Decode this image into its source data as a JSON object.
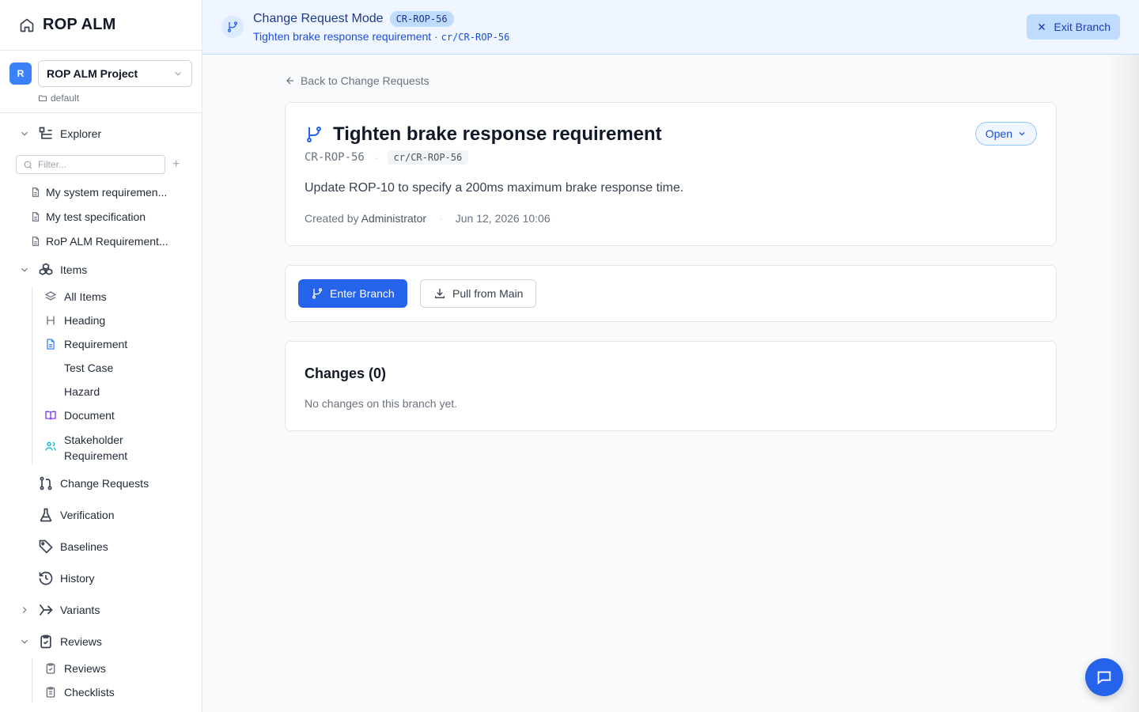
{
  "app": {
    "title": "ROP ALM"
  },
  "project": {
    "avatar": "R",
    "name": "ROP ALM Project",
    "folder": "default"
  },
  "explorer": {
    "label": "Explorer",
    "filter_placeholder": "Filter...",
    "documents": [
      "My system requiremen...",
      "My test specification",
      "RoP ALM Requirement..."
    ]
  },
  "items": {
    "label": "Items",
    "types": [
      {
        "label": "All Items",
        "icon": "layers-icon"
      },
      {
        "label": "Heading",
        "icon": "heading-icon"
      },
      {
        "label": "Requirement",
        "icon": "file-text-icon"
      },
      {
        "label": "Test Case",
        "icon": ""
      },
      {
        "label": "Hazard",
        "icon": ""
      },
      {
        "label": "Document",
        "icon": "book-open-icon"
      },
      {
        "label": "Stakeholder Requirement",
        "icon": "users-icon"
      }
    ]
  },
  "nav": {
    "change_requests": "Change Requests",
    "verification": "Verification",
    "baselines": "Baselines",
    "history": "History",
    "variants": "Variants",
    "reviews": "Reviews",
    "reviews_sub": [
      "Reviews",
      "Checklists"
    ]
  },
  "banner": {
    "title": "Change Request Mode",
    "badge": "CR-ROP-56",
    "subtitle": "Tighten brake response requirement",
    "separator": " · ",
    "branch": "cr/CR-ROP-56",
    "exit_label": "Exit Branch"
  },
  "back_link": "Back to Change Requests",
  "cr": {
    "title": "Tighten brake response requirement",
    "id": "CR-ROP-56",
    "branch": "cr/CR-ROP-56",
    "status": "Open",
    "description": "Update ROP-10 to specify a 200ms maximum brake response time.",
    "created_prefix": "Created by",
    "created_by": "Administrator",
    "created_at": "Jun 12, 2026 10:06"
  },
  "actions": {
    "enter_branch": "Enter Branch",
    "pull_from_main": "Pull from Main"
  },
  "changes": {
    "title": "Changes (0)",
    "empty": "No changes on this branch yet."
  },
  "colors": {
    "accent": "#2563eb",
    "banner_bg": "#eff6ff"
  }
}
